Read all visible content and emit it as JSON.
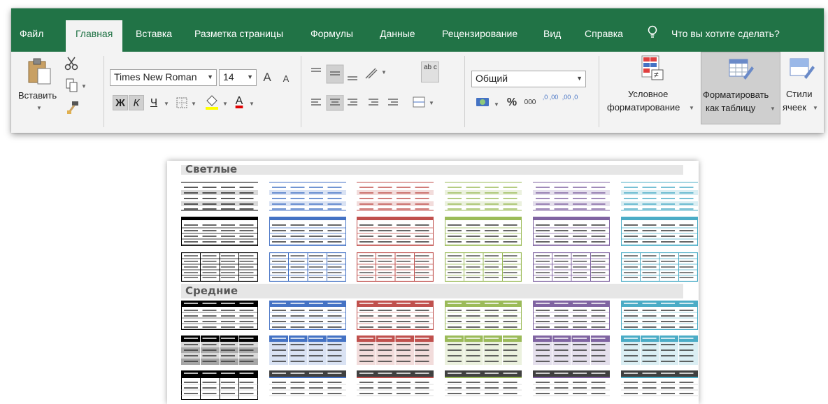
{
  "ribbon": {
    "tabs": [
      {
        "label": "Файл"
      },
      {
        "label": "Главная"
      },
      {
        "label": "Вставка"
      },
      {
        "label": "Разметка страницы"
      },
      {
        "label": "Формулы"
      },
      {
        "label": "Данные"
      },
      {
        "label": "Рецензирование"
      },
      {
        "label": "Вид"
      },
      {
        "label": "Справка"
      }
    ],
    "tell_me": "Что вы хотите сделать?",
    "clipboard": {
      "paste_label": "Вставить"
    },
    "font": {
      "name": "Times New Roman",
      "size": "14",
      "bold": "Ж",
      "italic": "К",
      "underline": "Ч",
      "grow": "A",
      "shrink": "A",
      "font_color": "A"
    },
    "alignment": {
      "wrap_icon": "ab c"
    },
    "number": {
      "format": "Общий",
      "percent": "%",
      "thousands": "000",
      "inc_dec": ",0 ,00",
      "dec_dec": ",00 ,0"
    },
    "styles": {
      "conditional_line1": "Условное",
      "conditional_line2": "форматирование",
      "format_table_line1": "Форматировать",
      "format_table_line2": "как таблицу",
      "cell_styles_line1": "Стили",
      "cell_styles_line2": "ячеек"
    },
    "colors": {
      "tabbar": "#217346",
      "active_tab_text": "#217346"
    }
  },
  "gallery": {
    "sections": [
      {
        "title": "Светлые"
      },
      {
        "title": "Средние"
      }
    ],
    "palette": [
      {
        "name": "black",
        "main": "#000000",
        "light": "#d9d9d9"
      },
      {
        "name": "blue",
        "main": "#4472c4",
        "light": "#d9e2f3"
      },
      {
        "name": "red",
        "main": "#c0504d",
        "light": "#f2dcdb"
      },
      {
        "name": "green",
        "main": "#9bbb59",
        "light": "#ebf1de"
      },
      {
        "name": "purple",
        "main": "#8064a2",
        "light": "#e4dfec"
      },
      {
        "name": "aqua",
        "main": "#4bacc6",
        "light": "#daeef3"
      }
    ],
    "rows": [
      {
        "section": 0,
        "style": "light-rows"
      },
      {
        "section": 0,
        "style": "light-header"
      },
      {
        "section": 0,
        "style": "light-grid"
      },
      {
        "section": 1,
        "style": "medium-header"
      },
      {
        "section": 1,
        "style": "medium-banded"
      },
      {
        "section": 1,
        "style": "medium-dark-header"
      }
    ]
  }
}
